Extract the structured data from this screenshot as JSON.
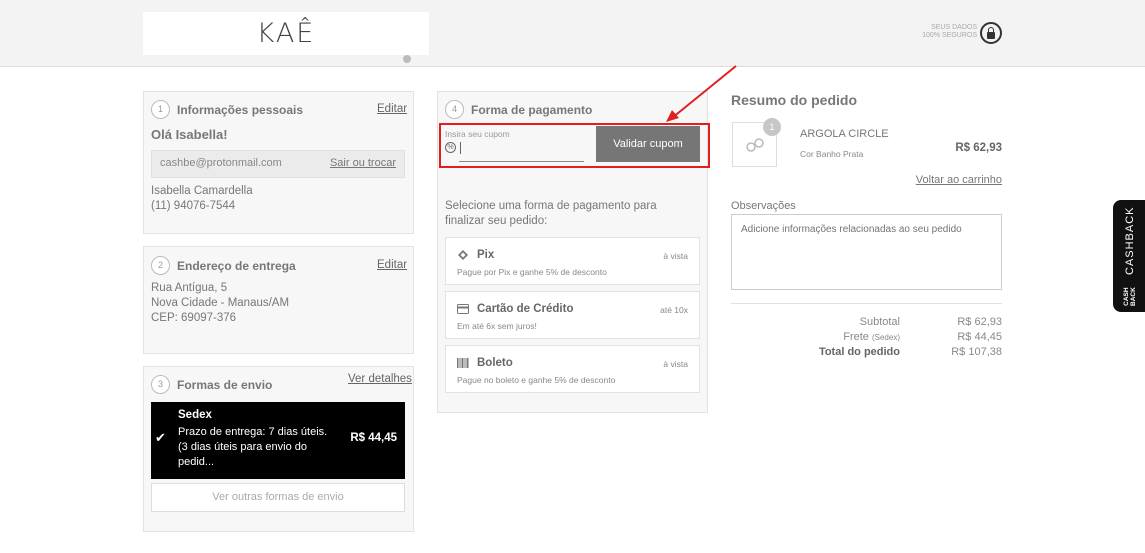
{
  "header": {
    "logo": "KAÊ",
    "secure_line1": "SEUS DADOS",
    "secure_line2": "100% SEGUROS"
  },
  "personal": {
    "step": "1",
    "title": "Informações pessoais",
    "edit": "Editar",
    "greeting": "Olá Isabella!",
    "email": "cashbe@protonmail.com",
    "switch": "Sair ou trocar",
    "name": "Isabella Camardella",
    "phone": "(11) 94076-7544"
  },
  "address": {
    "step": "2",
    "title": "Endereço de entrega",
    "edit": "Editar",
    "line1": "Rua Antígua, 5",
    "line2": "Nova Cidade - Manaus/AM",
    "line3": "CEP: 69097-376"
  },
  "shipping": {
    "step": "3",
    "title": "Formas de envio",
    "details": "Ver detalhes",
    "selected_name": "Sedex",
    "selected_info1": "Prazo de entrega: 7 dias úteis.",
    "selected_info2": "(3 dias úteis para envio do",
    "selected_info3": "pedid...",
    "selected_price": "R$ 44,45",
    "other": "Ver outras formas de envio"
  },
  "payment": {
    "step": "4",
    "title": "Forma de pagamento",
    "coupon_label": "Insira seu cupom",
    "coupon_value": "",
    "coupon_button": "Validar cupom",
    "select_text": "Selecione uma forma de pagamento para finalizar seu pedido:",
    "options": [
      {
        "name": "Pix",
        "desc": "Pague por Pix e ganhe 5% de desconto",
        "note": "à vista",
        "icon": "pix-icon"
      },
      {
        "name": "Cartão de Crédito",
        "desc": "Em até 6x sem juros!",
        "note": "até 10x",
        "icon": "credit-card-icon"
      },
      {
        "name": "Boleto",
        "desc": "Pague no boleto e ganhe 5% de desconto",
        "note": "à vista",
        "icon": "barcode-icon"
      }
    ]
  },
  "summary": {
    "title": "Resumo do pedido",
    "product": {
      "qty": "1",
      "name": "ARGOLA CIRCLE",
      "variant": "Cor Banho Prata",
      "price": "R$ 62,93"
    },
    "back_to_cart": "Voltar ao carrinho",
    "obs_label": "Observações",
    "obs_placeholder": "Adicione informações relacionadas ao seu pedido",
    "subtotal_label": "Subtotal",
    "subtotal": "R$ 62,93",
    "shipping_label": "Frete",
    "shipping_method": "(Sedex)",
    "shipping_value": "R$ 44,45",
    "total_label": "Total do pedido",
    "total": "R$ 107,38"
  },
  "cashback": {
    "main": "CASHBACK",
    "sub1": "CASH",
    "sub2": "BACK"
  },
  "colors": {
    "highlight": "#e02020",
    "selected_shipping": "#000000",
    "button": "#767676"
  }
}
